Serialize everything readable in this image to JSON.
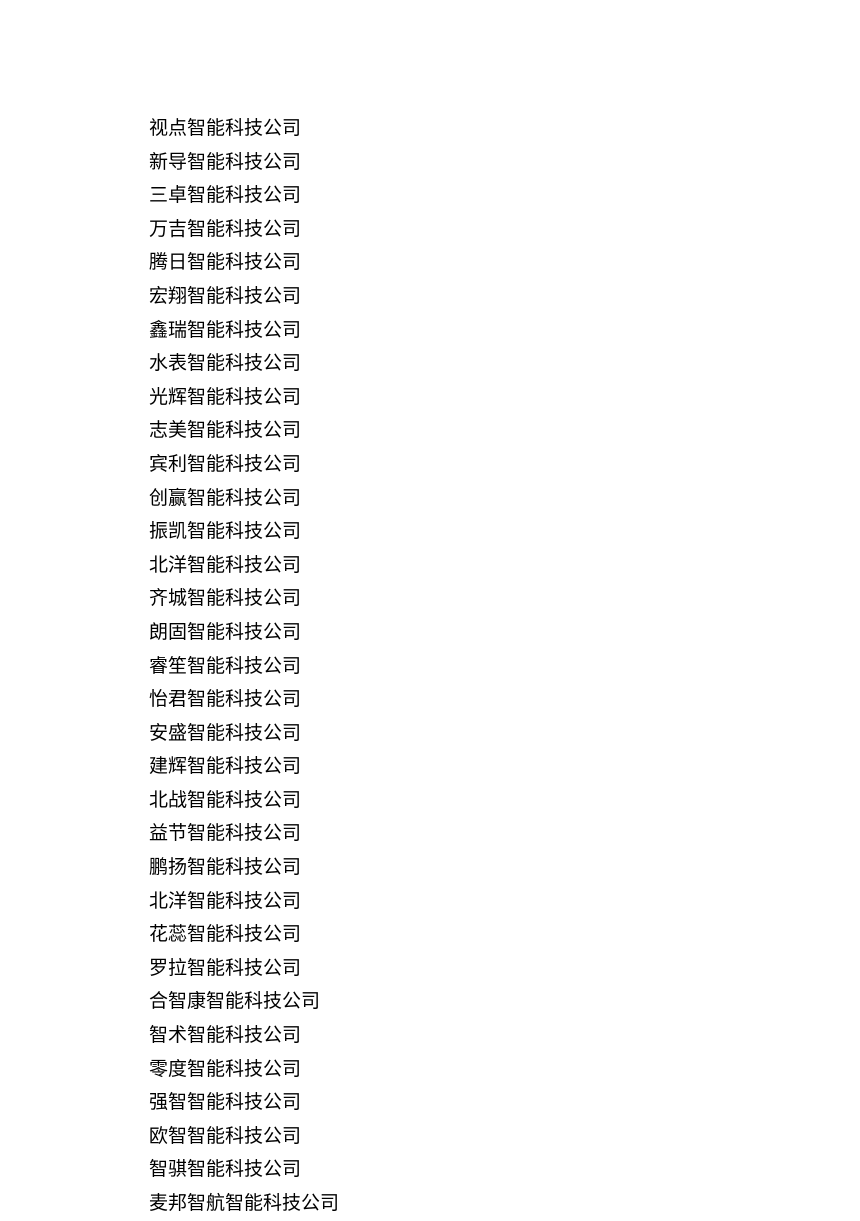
{
  "companies": [
    "视点智能科技公司",
    "新导智能科技公司",
    "三卓智能科技公司",
    "万吉智能科技公司",
    "腾日智能科技公司",
    "宏翔智能科技公司",
    "鑫瑞智能科技公司",
    "水表智能科技公司",
    "光辉智能科技公司",
    "志美智能科技公司",
    "宾利智能科技公司",
    "创赢智能科技公司",
    "振凯智能科技公司",
    "北洋智能科技公司",
    "齐城智能科技公司",
    "朗固智能科技公司",
    "睿笙智能科技公司",
    "怡君智能科技公司",
    "安盛智能科技公司",
    "建辉智能科技公司",
    "北战智能科技公司",
    "益节智能科技公司",
    "鹏扬智能科技公司",
    "北洋智能科技公司",
    "花蕊智能科技公司",
    "罗拉智能科技公司",
    "合智康智能科技公司",
    "智术智能科技公司",
    "零度智能科技公司",
    "强智智能科技公司",
    "欧智智能科技公司",
    "智骐智能科技公司",
    "麦邦智航智能科技公司"
  ]
}
